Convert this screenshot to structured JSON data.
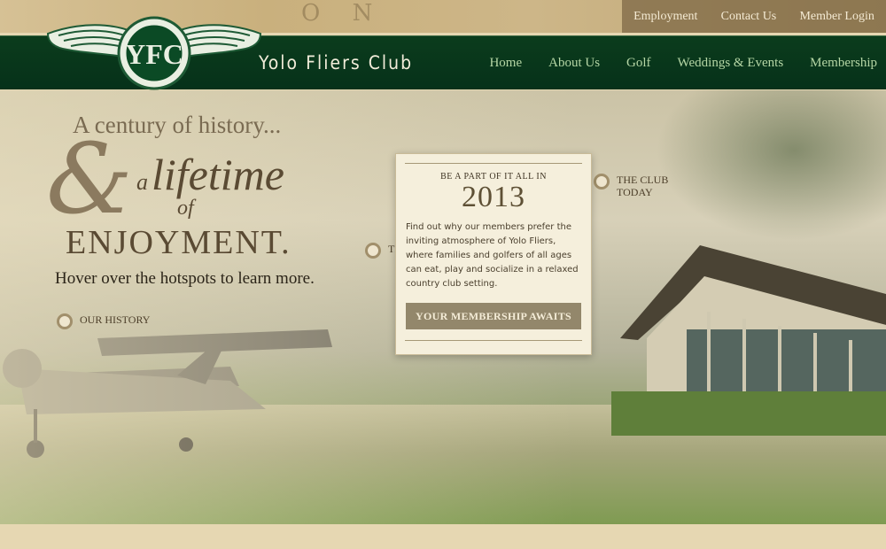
{
  "site": {
    "title": "Yolo Fliers Club",
    "logo_text": "YFC"
  },
  "top_nav": [
    "Employment",
    "Contact Us",
    "Member Login"
  ],
  "main_nav": [
    "Home",
    "About Us",
    "Golf",
    "Weddings & Events",
    "Membership"
  ],
  "hero": {
    "headline_1": "A century of history...",
    "ampersand": "&",
    "word_a": "a",
    "word_lifetime": "lifetime",
    "word_of": "of",
    "word_enjoyment": "ENJOYMENT.",
    "hover_text": "Hover over the hotspots to learn more."
  },
  "hotspots": {
    "history": "OUR HISTORY",
    "club_line1": "THE CLUB",
    "club_line2": "TODAY",
    "partial": "TI"
  },
  "popup": {
    "kicker": "BE A PART OF IT ALL IN",
    "year": "2013",
    "body": "Find out why our members prefer the inviting atmosphere of Yolo Fliers, where families and golfers of all ages can eat, play and socialize in a relaxed country club setting.",
    "cta": "YOUR MEMBERSHIP AWAITS"
  },
  "colors": {
    "nav_green": "#06311a",
    "nav_link": "#b5d6a5",
    "accent_tan": "#93876b"
  }
}
